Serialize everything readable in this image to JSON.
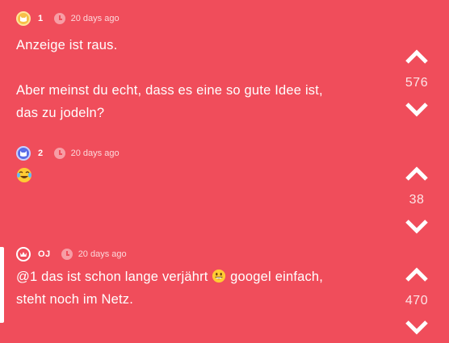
{
  "posts": [
    {
      "user": "1",
      "avatar_color": "#f7c04a",
      "time": "20 days ago",
      "lines": [
        "Anzeige ist raus.",
        "",
        "Aber meinst du echt, dass es eine so gute Idee ist,",
        "das zu jodeln?"
      ],
      "votes": "576"
    },
    {
      "user": "2",
      "avatar_color": "#5b6ee8",
      "time": "20 days ago",
      "emoji": "laughing-crying-emoji",
      "votes": "38"
    },
    {
      "user": "OJ",
      "avatar_color": "outline-crown",
      "time": "20 days ago",
      "text_before_emoji": "@1 das ist schon lange verjährt",
      "emoji": "grinning-emoji",
      "text_after_emoji": "googel einfach,",
      "line2": "steht noch im Netz.",
      "votes": "470"
    }
  ],
  "colors": {
    "background": "#f04d5b",
    "text": "#ffffff"
  }
}
